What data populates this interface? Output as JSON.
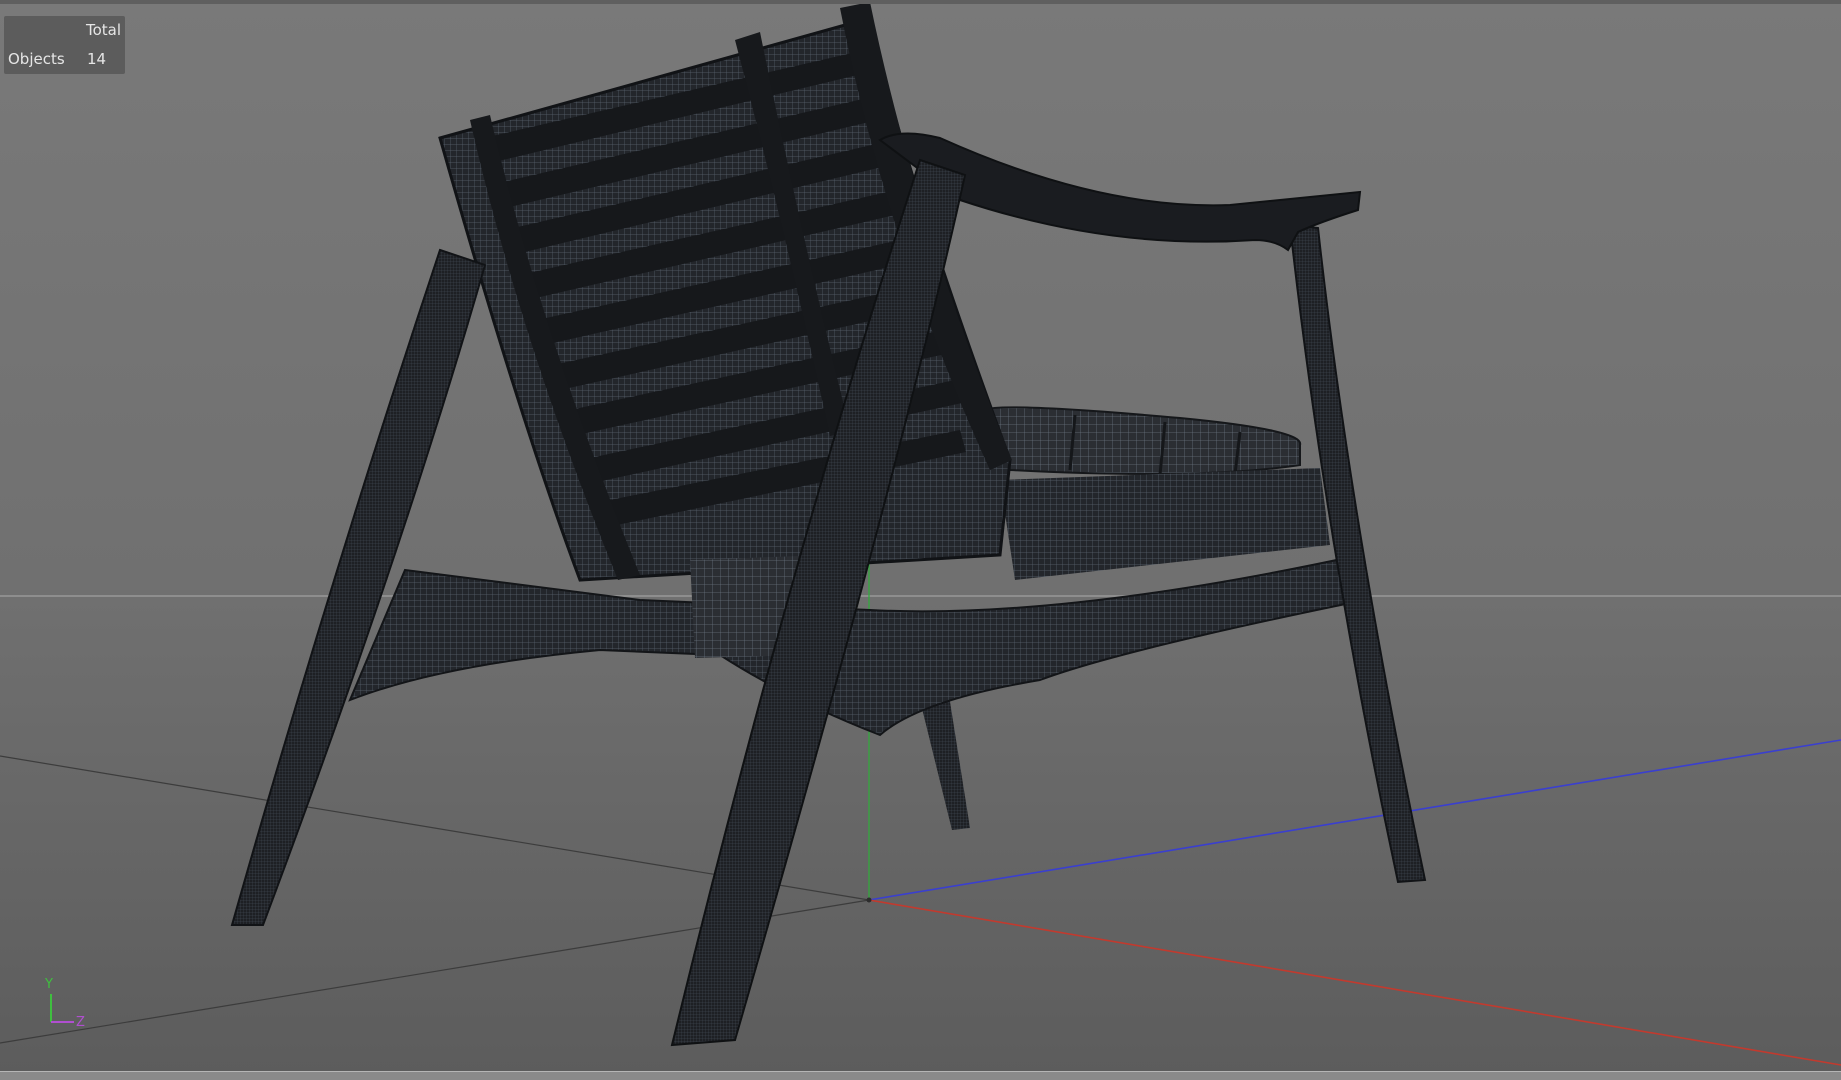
{
  "hud": {
    "header": "Total",
    "objects_label": "Objects",
    "objects_count": "14"
  },
  "axes": {
    "y_label": "Y",
    "z_label": "Z",
    "colors": {
      "x_axis": "#c23a2e",
      "y_axis": "#2fae3a",
      "z_axis": "#3a3fd0",
      "y_gizmo": "#3fbf3f",
      "z_gizmo": "#b04fd0"
    }
  },
  "scene": {
    "object": "wireframe-armchair",
    "background_top": "#7a7a7a",
    "background_bottom": "#5e5e5e",
    "mesh_color": "#1b1d21",
    "wire_color": "#5f6a78"
  }
}
